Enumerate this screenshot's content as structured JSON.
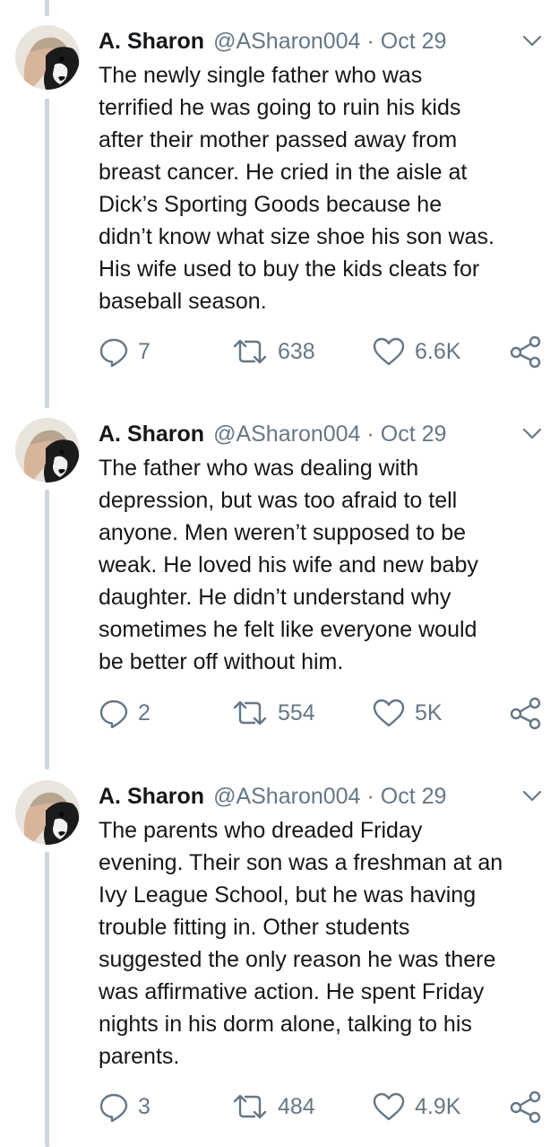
{
  "tweets": [
    {
      "name": "A. Sharon",
      "handle": "@ASharon004",
      "separator": "·",
      "date": "Oct 29",
      "lines": [
        "The newly single father who was",
        "terrified he was going to ruin his kids",
        "after their mother passed away from",
        "breast cancer. He cried in the aisle at",
        "Dick’s Sporting Goods because he",
        "didn’t know what size shoe his son was.",
        "His wife used to buy the kids cleats for",
        "baseball season."
      ],
      "replies": "7",
      "retweets": "638",
      "likes": "6.6K"
    },
    {
      "name": "A. Sharon",
      "handle": "@ASharon004",
      "separator": "·",
      "date": "Oct 29",
      "lines": [
        "The father who was dealing with",
        "depression, but was too afraid to tell",
        "anyone. Men weren’t supposed to be",
        "weak. He loved his wife and new baby",
        "daughter. He didn’t understand why",
        "sometimes he felt like everyone would",
        "be better off without him."
      ],
      "replies": "2",
      "retweets": "554",
      "likes": "5K"
    },
    {
      "name": "A. Sharon",
      "handle": "@ASharon004",
      "separator": "·",
      "date": "Oct 29",
      "lines": [
        "The parents who dreaded Friday",
        "evening. Their son was a freshman at an",
        "Ivy League School, but he was having",
        "trouble fitting in. Other students",
        "suggested the only reason he was there",
        "was affirmative action. He spent Friday",
        "nights in his dorm alone, talking to his",
        "parents."
      ],
      "replies": "3",
      "retweets": "484",
      "likes": "4.9K"
    }
  ],
  "colors": {
    "text": "#14171a",
    "secondary": "#657786",
    "thread_line": "#ccd6dd"
  },
  "icons": {
    "reply": "reply-icon",
    "retweet": "retweet-icon",
    "like": "like-icon",
    "share": "share-icon",
    "menu": "chevron-down-icon"
  }
}
